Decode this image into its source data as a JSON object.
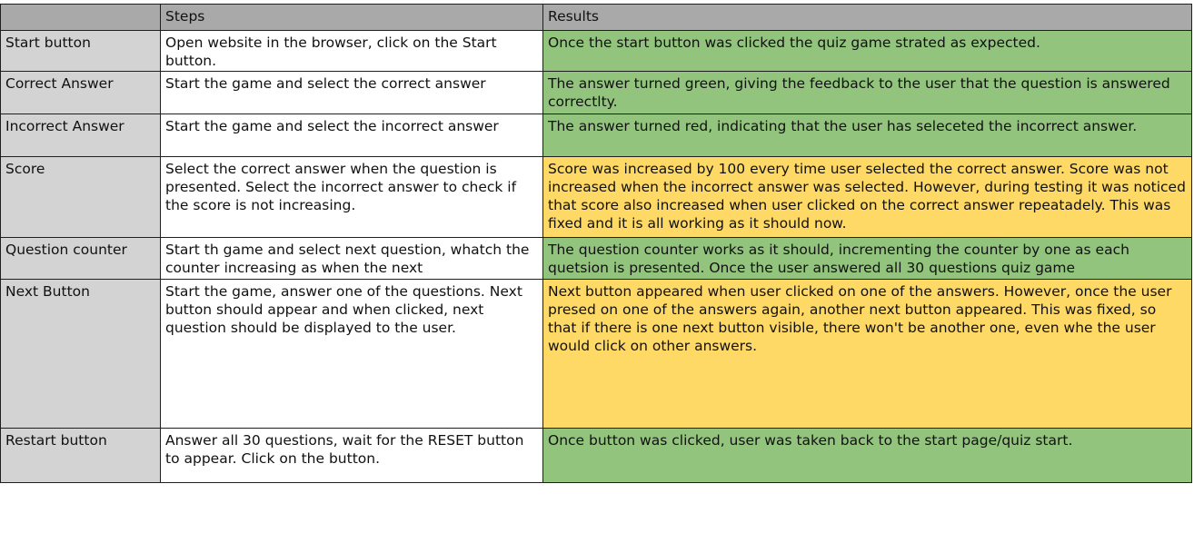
{
  "colors": {
    "header": "#a9a9a9",
    "name_column": "#d3d3d3",
    "pass": "#93c47d",
    "warning": "#ffd966"
  },
  "table": {
    "headers": [
      "",
      "Steps",
      "Results"
    ],
    "rows": [
      {
        "feature": "Start button",
        "steps": "Open website in the browser, click on the Start button.",
        "result": "Once the start button was clicked the quiz game strated as expected.",
        "status": "pass"
      },
      {
        "feature": "Correct Answer",
        "steps": "Start the game and select the correct answer",
        "result": "The answer turned green, giving the feedback to the user that the question is answered correctlty.",
        "status": "pass"
      },
      {
        "feature": "Incorrect Answer",
        "steps": "Start the game and select the incorrect answer",
        "result": "The answer turned red, indicating that the user has seleceted the incorrect answer.",
        "status": "pass"
      },
      {
        "feature": "Score",
        "steps": "Select the correct answer when the question is presented. Select the incorrect answer to check if the score is not increasing.",
        "result": "Score was increased by 100 every time user selected the correct answer. Score was not increased when the incorrect answer was selected. However, during testing it was noticed that score also increased when user clicked on the correct answer repeatadely. This was fixed and it is all working as it should now.",
        "status": "warning"
      },
      {
        "feature": "Question counter",
        "steps": "Start th game and select next question, whatch the counter increasing as  when the next",
        "result": "The question counter works as it should, incrementing the counter by one as each quetsion is presented. Once the user answered all 30 questions quiz game",
        "status": "pass"
      },
      {
        "feature": "Next Button",
        "steps": "Start the game, answer one of the questions. Next button should appear and  when clicked, next question should be displayed to the user.",
        "result": "Next button appeared when user clicked on one of the answers. However, once the user presed on one of the answers again, another next button appeared. This was fixed, so that if there is one next button visible, there won't be another one, even whe the user would click on other answers.",
        "status": "warning"
      },
      {
        "feature": "Restart button",
        "steps": "Answer all 30 questions, wait for the RESET button to appear. Click on the button.",
        "result": "Once button was clicked, user was taken back to the start page/quiz start.",
        "status": "pass"
      }
    ]
  }
}
